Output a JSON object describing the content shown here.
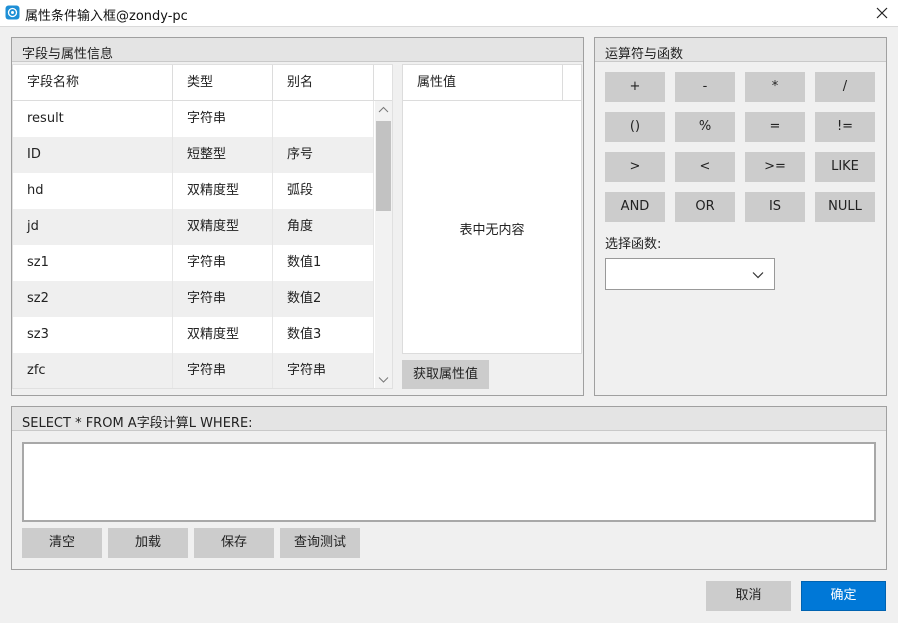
{
  "window": {
    "title": "属性条件输入框@zondy-pc"
  },
  "fields_group": {
    "title": "字段与属性信息",
    "columns": [
      "字段名称",
      "类型",
      "别名"
    ],
    "rows": [
      {
        "name": "result",
        "type": "字符串",
        "alias": ""
      },
      {
        "name": "ID",
        "type": "短整型",
        "alias": "序号"
      },
      {
        "name": "hd",
        "type": "双精度型",
        "alias": "弧段"
      },
      {
        "name": "jd",
        "type": "双精度型",
        "alias": "角度"
      },
      {
        "name": "sz1",
        "type": "字符串",
        "alias": "数值1"
      },
      {
        "name": "sz2",
        "type": "字符串",
        "alias": "数值2"
      },
      {
        "name": "sz3",
        "type": "双精度型",
        "alias": "数值3"
      },
      {
        "name": "zfc",
        "type": "字符串",
        "alias": "字符串"
      }
    ],
    "attr_header": "属性值",
    "attr_empty": "表中无内容",
    "get_attr_button": "获取属性值"
  },
  "operators_group": {
    "title": "运算符与函数",
    "operators": [
      "+",
      "-",
      "*",
      "/",
      "()",
      "%",
      "=",
      "!=",
      ">",
      "<",
      ">=",
      "LIKE",
      "AND",
      "OR",
      "IS",
      "NULL"
    ],
    "func_label": "选择函数:",
    "func_selected": ""
  },
  "sql_group": {
    "title": "SELECT * FROM A字段计算L WHERE:",
    "value": "",
    "buttons": [
      "清空",
      "加载",
      "保存",
      "查询测试"
    ]
  },
  "footer": {
    "cancel": "取消",
    "ok": "确定"
  },
  "colors": {
    "primary": "#0078d7",
    "button": "#cccccc",
    "panel": "#f0f0f0"
  }
}
